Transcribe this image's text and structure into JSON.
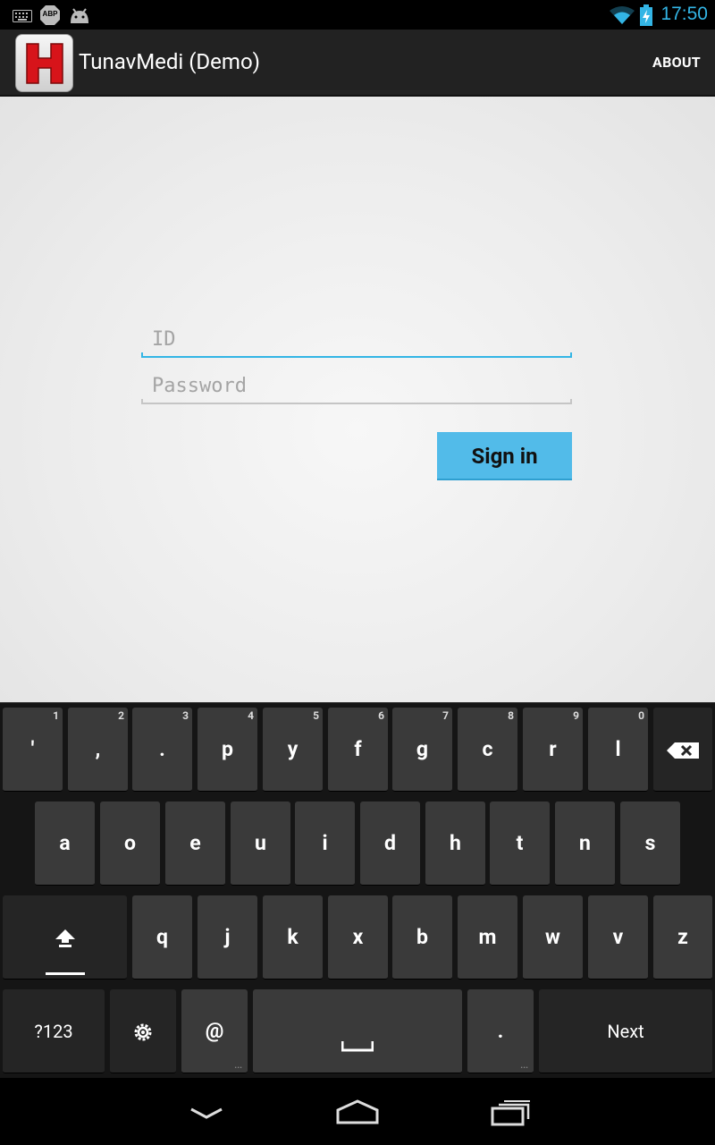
{
  "status_bar": {
    "time": "17:50",
    "left_icons": [
      "keyboard-icon",
      "adblock-icon",
      "android-debug-icon"
    ],
    "right_icons": [
      "wifi-icon",
      "battery-charging-icon"
    ],
    "adblock_label": "ABP"
  },
  "action_bar": {
    "app_icon_letter": "H",
    "title": "TunavMedi (Demo)",
    "about_label": "ABOUT"
  },
  "login": {
    "id_placeholder": "ID",
    "password_placeholder": "Password",
    "sign_in_label": "Sign in"
  },
  "keyboard": {
    "row1": [
      {
        "label": "'",
        "hint": "1"
      },
      {
        "label": ",",
        "hint": "2"
      },
      {
        "label": ".",
        "hint": "3"
      },
      {
        "label": "p",
        "hint": "4"
      },
      {
        "label": "y",
        "hint": "5"
      },
      {
        "label": "f",
        "hint": "6"
      },
      {
        "label": "g",
        "hint": "7"
      },
      {
        "label": "c",
        "hint": "8"
      },
      {
        "label": "r",
        "hint": "9"
      },
      {
        "label": "l",
        "hint": "0"
      }
    ],
    "row2": [
      "a",
      "o",
      "e",
      "u",
      "i",
      "d",
      "h",
      "t",
      "n",
      "s"
    ],
    "row3": [
      "q",
      "j",
      "k",
      "x",
      "b",
      "m",
      "w",
      "v",
      "z"
    ],
    "symbols_label": "?123",
    "at_label": "@",
    "period_label": ".",
    "next_label": "Next"
  },
  "colors": {
    "accent": "#33b5e5",
    "button": "#52bbe9",
    "app_red": "#d7141a"
  }
}
